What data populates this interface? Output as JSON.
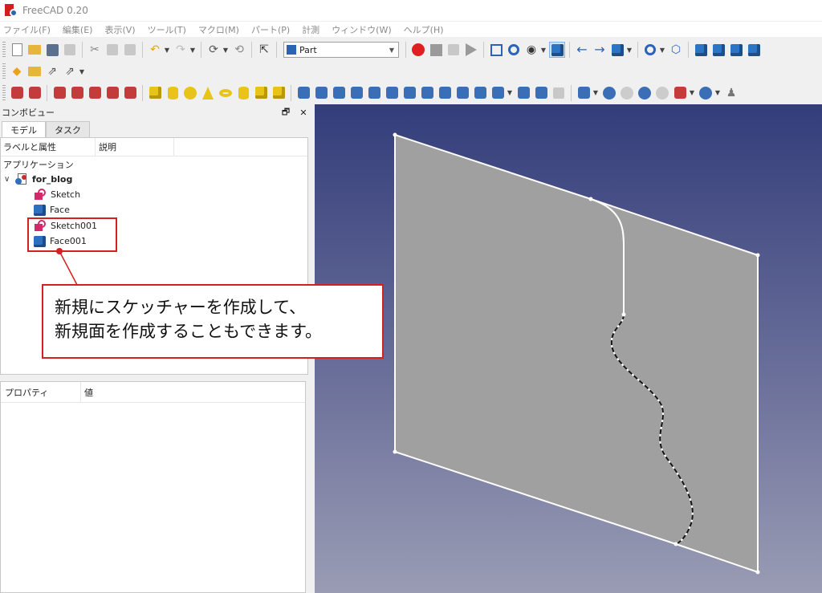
{
  "window": {
    "title": "FreeCAD 0.20"
  },
  "menu": [
    "ファイル(F)",
    "編集(E)",
    "表示(V)",
    "ツール(T)",
    "マクロ(M)",
    "パート(P)",
    "計測",
    "ウィンドウ(W)",
    "ヘルプ(H)"
  ],
  "toolbar": {
    "workbench_label": "Part"
  },
  "combo_view": {
    "title": "コンボビュー",
    "float_button": "🗗",
    "close_button": "✕",
    "tabs": [
      "モデル",
      "タスク"
    ]
  },
  "tree": {
    "col_label": "ラベルと属性",
    "col_desc": "説明",
    "section": "アプリケーション",
    "document": "for_blog",
    "items": [
      "Sketch",
      "Face",
      "Sketch001",
      "Face001"
    ]
  },
  "properties": {
    "col_name": "プロパティ",
    "col_value": "値"
  },
  "callout": {
    "line1": "新規にスケッチャーを作成して、",
    "line2": "新規面を作成することもできます。"
  },
  "colors": {
    "accent_red": "#d42020",
    "face_gray": "#a0a0a0"
  }
}
